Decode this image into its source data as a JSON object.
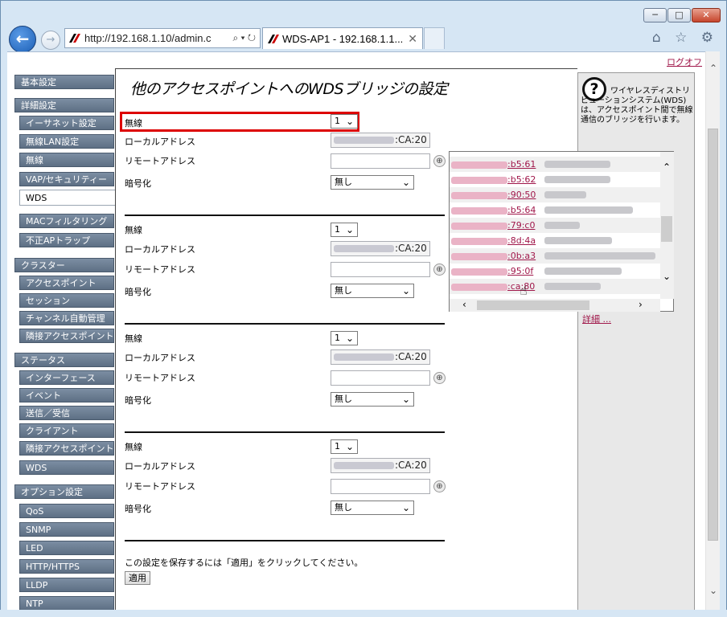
{
  "browser": {
    "window_controls": {
      "minimize": "─",
      "maximize": "□",
      "close": "✕"
    },
    "back_icon": "back-arrow-icon",
    "forward_icon": "forward-arrow-icon",
    "address": "http://192.168.1.10/admin.c",
    "address_tools": "⌕ ▾ ↻",
    "tab_title": "WDS-AP1 - 192.168.1.1...",
    "tab_close": "✕",
    "toolbar_icons": "⌂ ☆ ⚙"
  },
  "header": {
    "logout": "ログオフ"
  },
  "sidebar": {
    "items": [
      {
        "label": "基本設定",
        "kind": "cat"
      },
      {
        "label": "詳細設定",
        "kind": "cat"
      },
      {
        "label": "イーサネット設定",
        "kind": "sub"
      },
      {
        "label": "無線LAN設定",
        "kind": "sub"
      },
      {
        "label": "無線",
        "kind": "sub"
      },
      {
        "label": "VAP/セキュリティー",
        "kind": "sub"
      },
      {
        "label": "WDS",
        "kind": "sub",
        "active": true
      },
      {
        "label": "MACフィルタリング",
        "kind": "sub"
      },
      {
        "label": "不正APトラップ",
        "kind": "sub"
      },
      {
        "label": "クラスター",
        "kind": "cat"
      },
      {
        "label": "アクセスポイント",
        "kind": "sub"
      },
      {
        "label": "セッション",
        "kind": "sub"
      },
      {
        "label": "チャンネル自動管理",
        "kind": "sub"
      },
      {
        "label": "隣接アクセスポイント",
        "kind": "sub"
      },
      {
        "label": "ステータス",
        "kind": "cat"
      },
      {
        "label": "インターフェース",
        "kind": "sub"
      },
      {
        "label": "イベント",
        "kind": "sub"
      },
      {
        "label": "送信／受信",
        "kind": "sub"
      },
      {
        "label": "クライアント",
        "kind": "sub"
      },
      {
        "label": "隣接アクセスポイント",
        "kind": "sub"
      },
      {
        "label": "WDS",
        "kind": "sub"
      },
      {
        "label": "オプション設定",
        "kind": "cat"
      },
      {
        "label": "QoS",
        "kind": "sub"
      },
      {
        "label": "SNMP",
        "kind": "sub"
      },
      {
        "label": "LED",
        "kind": "sub"
      },
      {
        "label": "HTTP/HTTPS",
        "kind": "sub"
      },
      {
        "label": "LLDP",
        "kind": "sub"
      },
      {
        "label": "NTP",
        "kind": "sub"
      }
    ]
  },
  "main": {
    "title": "他のアクセスポイントへのWDSブリッジの設定",
    "labels": {
      "radio": "無線",
      "local": "ローカルアドレス",
      "remote": "リモートアドレス",
      "encryption": "暗号化"
    },
    "bridges": [
      {
        "radio": "1",
        "local_suffix": ":CA:20",
        "remote": "",
        "encryption": "無し"
      },
      {
        "radio": "1",
        "local_suffix": ":CA:20",
        "remote": "",
        "encryption": "無し"
      },
      {
        "radio": "1",
        "local_suffix": ":CA:20",
        "remote": "",
        "encryption": "無し"
      },
      {
        "radio": "1",
        "local_suffix": ":CA:20",
        "remote": "",
        "encryption": "無し"
      }
    ],
    "apply_note": "この設定を保存するには「適用」をクリックしてください。",
    "apply_button": "適用"
  },
  "help": {
    "text": "ワイヤレスディストリビューションシステム(WDS)は、アクセスポイント間で無線通信のブリッジを行います。",
    "more_link": "詳細 ..."
  },
  "popup": {
    "rows": [
      {
        "mac_suffix": ":b5:61"
      },
      {
        "mac_suffix": ":b5:62"
      },
      {
        "mac_suffix": ":90:50"
      },
      {
        "mac_suffix": ":b5:64"
      },
      {
        "mac_suffix": ":79:c0"
      },
      {
        "mac_suffix": ":8d:4a"
      },
      {
        "mac_suffix": ":0b:a3"
      },
      {
        "mac_suffix": ":95:0f"
      },
      {
        "mac_suffix": ":ca:80"
      }
    ]
  }
}
